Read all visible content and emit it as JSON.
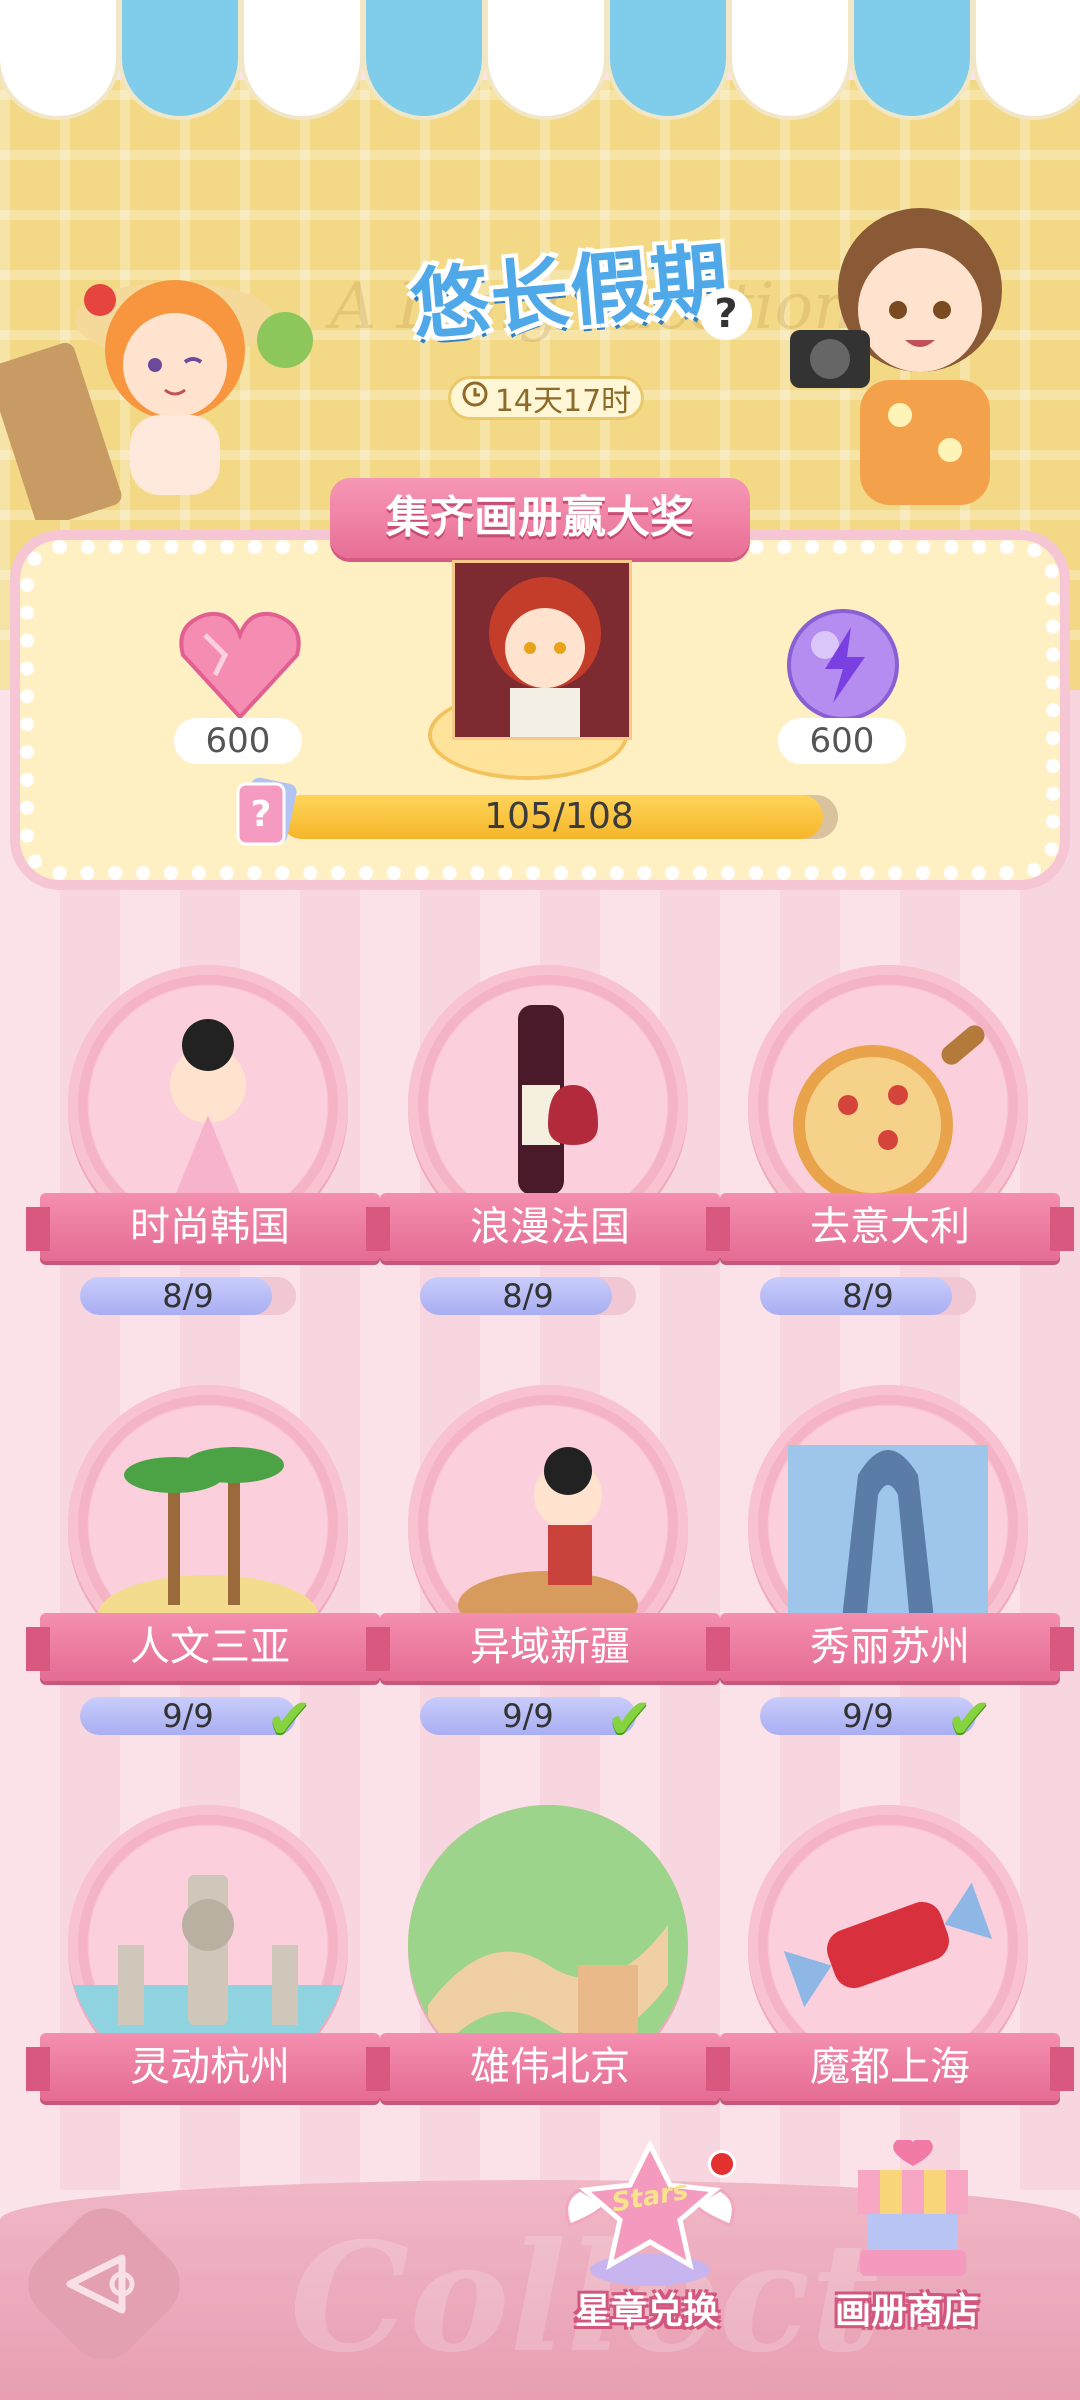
{
  "event": {
    "title": "悠长假期",
    "watermark": "A Long vacation",
    "help": "?",
    "timer": "14天17时"
  },
  "reward": {
    "ribbon": "集齐画册赢大奖",
    "left_amount": "600",
    "right_amount": "600",
    "progress_text": "105/108",
    "progress_current": 105,
    "progress_total": 108
  },
  "albums": [
    {
      "name": "时尚韩国",
      "progress": "8/9",
      "done": 8,
      "total": 9,
      "complete": false
    },
    {
      "name": "浪漫法国",
      "progress": "8/9",
      "done": 8,
      "total": 9,
      "complete": false
    },
    {
      "name": "去意大利",
      "progress": "8/9",
      "done": 8,
      "total": 9,
      "complete": false
    },
    {
      "name": "人文三亚",
      "progress": "9/9",
      "done": 9,
      "total": 9,
      "complete": true
    },
    {
      "name": "异域新疆",
      "progress": "9/9",
      "done": 9,
      "total": 9,
      "complete": true
    },
    {
      "name": "秀丽苏州",
      "progress": "9/9",
      "done": 9,
      "total": 9,
      "complete": true
    },
    {
      "name": "灵动杭州"
    },
    {
      "name": "雄伟北京"
    },
    {
      "name": "魔都上海"
    }
  ],
  "footer": {
    "star_exchange": "星章兑换",
    "star_badge_text": "Stars",
    "album_shop": "画册商店",
    "watermark": "Collect"
  },
  "colors": {
    "awning_blue": "#7fcdeb",
    "header_yellow": "#f3d985",
    "pink_accent": "#e86e95",
    "progress_yellow": "#f5b62a",
    "check_green": "#85d33e"
  }
}
